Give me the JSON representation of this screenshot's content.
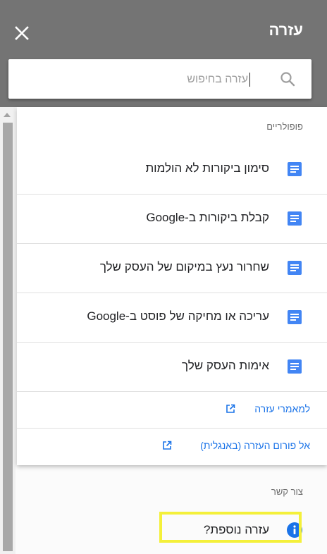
{
  "header": {
    "title": "עזרה"
  },
  "search": {
    "placeholder": "עזרה בחיפוש"
  },
  "popular": {
    "label": "פופולריים",
    "items": [
      {
        "label": "סימון ביקורות לא הולמות"
      },
      {
        "label": "קבלת ביקורות ב-Google"
      },
      {
        "label": "שחרור נעץ במיקום של העסק שלך"
      },
      {
        "label": "עריכה או מחיקה של פוסט ב-Google"
      },
      {
        "label": "אימות העסק שלך"
      }
    ]
  },
  "links": {
    "help_articles": "למאמרי עזרה",
    "help_forum": "אל פורום העזרה (באנגלית)"
  },
  "contact": {
    "label": "צור קשר",
    "more_help": "עזרה נוספת?"
  },
  "colors": {
    "header_bg": "#747474",
    "accent": "#1a73e8",
    "doc_icon": "#4285f4",
    "highlight": "#f4f03a"
  },
  "icons": {
    "close": "close-icon",
    "search": "search-icon",
    "doc": "document-icon",
    "external": "external-link-icon",
    "info": "info-icon"
  }
}
